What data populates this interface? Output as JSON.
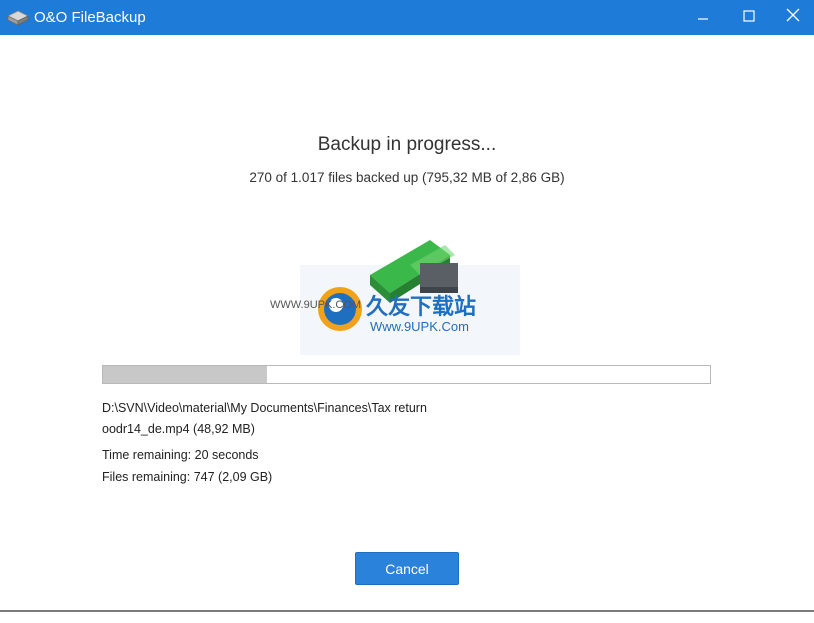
{
  "window": {
    "title": "O&O FileBackup",
    "icon": "hard-drive-icon",
    "controls": [
      "minimize-icon",
      "maximize-icon",
      "close-icon"
    ]
  },
  "status": {
    "heading": "Backup in progress...",
    "summary": "270 of 1.017 files backed up (795,32 MB of 2,86 GB)"
  },
  "progress": {
    "fraction": 0.27
  },
  "details": {
    "current_path": "D:\\SVN\\Video\\material\\My Documents\\Finances\\Tax return",
    "current_file": "oodr14_de.mp4 (48,92 MB)",
    "time_remaining": "Time remaining: 20 seconds",
    "files_remaining": "Files remaining: 747 (2,09 GB)"
  },
  "actions": {
    "cancel_label": "Cancel"
  },
  "watermark": {
    "url_left": "WWW.9UPK.COM",
    "brand": "久友下载站",
    "url": "Www.9UPK.Com"
  },
  "colors": {
    "titlebar": "#1e7bd8",
    "button": "#2a82da",
    "progress_fill": "#c8c8c8"
  }
}
